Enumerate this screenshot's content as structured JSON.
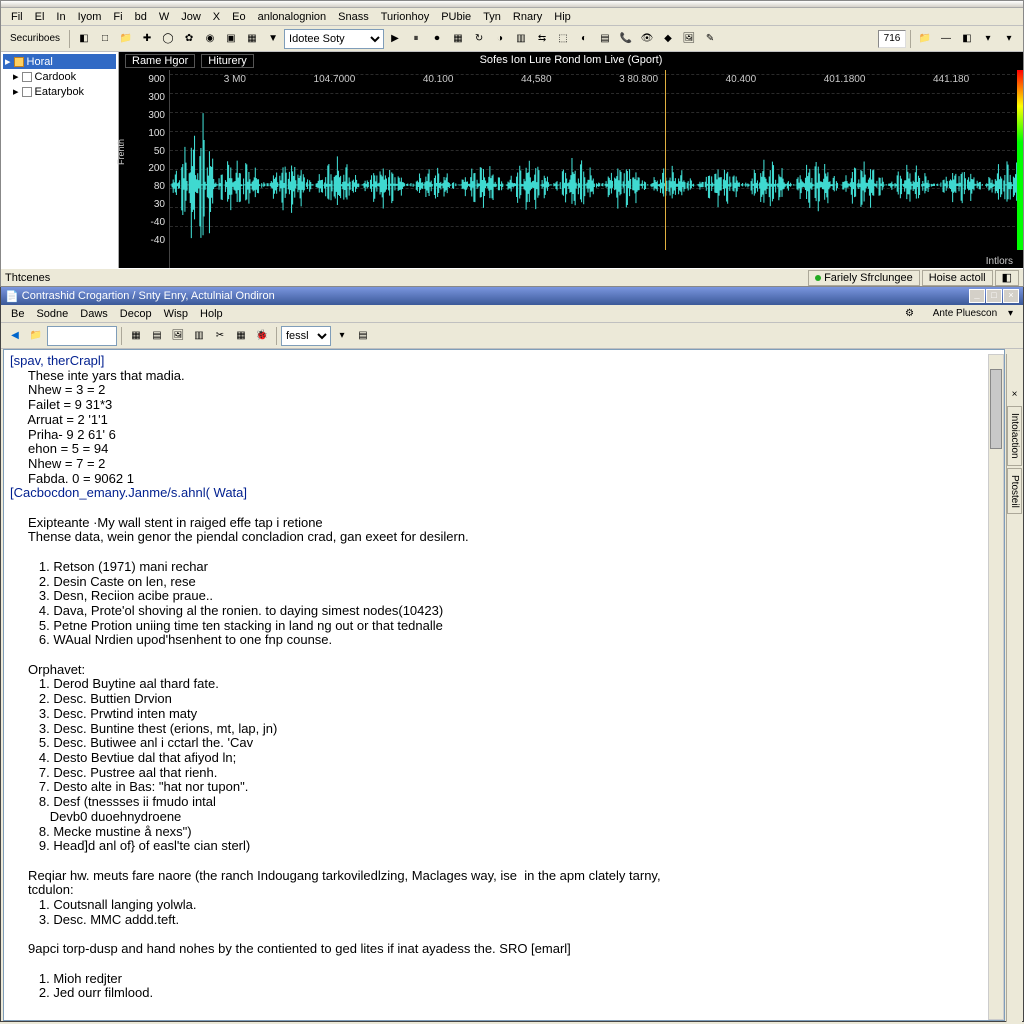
{
  "top_menu": [
    "Fil",
    "El",
    "In",
    "Iyom",
    "Fi",
    "bd",
    "W",
    "Jow",
    "X",
    "Eo",
    "anlonalognion",
    "Snass",
    "Turionhoy",
    "PUbie",
    "Tyn",
    "Rnary",
    "Hip"
  ],
  "top_toolbar": {
    "buttons": [
      "seq",
      "◧",
      "□",
      "📁",
      "✚",
      "◯",
      "✿",
      "◉",
      "▣",
      "▦",
      "▼",
      "sel",
      "▶",
      "⏸",
      "⏺",
      "▦",
      "↻",
      "◑",
      "▥",
      "⇆",
      "⬚",
      "◐",
      "▤",
      "📞",
      "👁",
      "◆",
      "🖼",
      "✎"
    ],
    "seq_label": "Securiboes",
    "select_value": "Idotee Soty",
    "num_display": "716",
    "right_icons": [
      "📁",
      "—",
      "◧",
      "▾",
      "▾"
    ]
  },
  "tree": {
    "root": "Horal",
    "items": [
      "Cardook",
      "Eatarybok"
    ]
  },
  "wave": {
    "tab_left": [
      "Rame Hgor",
      "Hiturery"
    ],
    "title": "Sofes Ion Lure Rond lom Live (Gport)",
    "ylabels": [
      "900",
      "300",
      "300",
      "100",
      "50",
      "200",
      "80",
      "30",
      "-40",
      "-40"
    ],
    "yaxis_label": "Frenth",
    "xlabels": [
      "3 M0",
      "104.7000",
      "40.100",
      "44,580",
      "3 80.800",
      "40.400",
      "401.1800",
      "441.180"
    ],
    "xunit": "Intlors"
  },
  "status": {
    "left": "Thtcenes",
    "r1": "Fariely Sfrclungee",
    "r2": "Hoise actoll"
  },
  "bot_title": "Contrashid Crogartion / Snty Enry, Actulnial Ondiron",
  "bot_menu": [
    "Be",
    "Sodne",
    "Daws",
    "Decop",
    "Wisp",
    "Holp"
  ],
  "bot_tool_right": "Ante Pluescon",
  "bot_toolbar": {
    "search": "",
    "combo": "fessl"
  },
  "right_tabs": [
    "Intoiaction",
    "Ptosteil"
  ],
  "editor_lines": [
    {
      "t": "[spav, therCrapl]",
      "c": "hdr"
    },
    {
      "t": "     These inte yars that madia.",
      "c": ""
    },
    {
      "t": "     Nhew = 3 = 2",
      "c": ""
    },
    {
      "t": "     Failet = 9 31*3",
      "c": ""
    },
    {
      "t": "     Arruat = 2 '1'1",
      "c": ""
    },
    {
      "t": "     Priha- 9 2 61' 6",
      "c": ""
    },
    {
      "t": "     ehon = 5 = 94",
      "c": ""
    },
    {
      "t": "     Nhew = 7 = 2",
      "c": ""
    },
    {
      "t": "     Fabda. 0 = 9062 1",
      "c": ""
    },
    {
      "t": "[Cacbocdon_emany.Janme/s.ahnl( Wata]",
      "c": "hdr"
    },
    {
      "t": "",
      "c": ""
    },
    {
      "t": "     Exipteante ·My wall stent in raiged effe tap i retione",
      "c": ""
    },
    {
      "t": "     Thense data, wein genor the piendal concladion crad, gan exeet for desilern.",
      "c": ""
    },
    {
      "t": "",
      "c": ""
    },
    {
      "t": "        1. Retson (1971) mani rechar",
      "c": ""
    },
    {
      "t": "        2. Desin Caste on len, rese",
      "c": ""
    },
    {
      "t": "        3. Desn, Reciion acibe praue..",
      "c": ""
    },
    {
      "t": "        4. Dava, Prote'ol shoving al the ronien. to daying simest nodes(10423)",
      "c": ""
    },
    {
      "t": "        5. Petne Protion uniing time ten stacking in land ng out or that tednalle",
      "c": ""
    },
    {
      "t": "        6. WAual Nrdien upod'hsenhent to one fnp counse.",
      "c": ""
    },
    {
      "t": "",
      "c": ""
    },
    {
      "t": "     Orphavet:",
      "c": ""
    },
    {
      "t": "        1. Derod Buytine aal thard fate.",
      "c": ""
    },
    {
      "t": "        2. Desc. Buttien Drvion",
      "c": ""
    },
    {
      "t": "        3. Desc. Prwtind inten maty",
      "c": ""
    },
    {
      "t": "        3. Desc. Buntine thest (erions, mt, lap, jn)",
      "c": ""
    },
    {
      "t": "        5. Desc. Butiwee anl i cctarl the. 'Cav",
      "c": ""
    },
    {
      "t": "        4. Desto Bevtiue dal that afiyod ln;",
      "c": ""
    },
    {
      "t": "        7. Desc. Pustree aal that rienh.",
      "c": ""
    },
    {
      "t": "        7. Desto alte in Bas: \"hat nor tupon\".",
      "c": ""
    },
    {
      "t": "        8. Desf (tnessses ii fmudo intal",
      "c": ""
    },
    {
      "t": "           Devb0 duoehnydroene",
      "c": ""
    },
    {
      "t": "        8. Mecke mustine å nexs\")",
      "c": ""
    },
    {
      "t": "        9. Head]d anl of} of easl'te cian sterl)",
      "c": ""
    },
    {
      "t": "",
      "c": ""
    },
    {
      "t": "     Reqiar hw. meuts fare naore (the ranch Indougang tarkoviledlzing, Maclages way, ise  in the apm clately tarny,",
      "c": ""
    },
    {
      "t": "     tcdulon:",
      "c": ""
    },
    {
      "t": "        1. Coutsnall langing yolwla.",
      "c": ""
    },
    {
      "t": "        3. Desc. MMC addd.teft.",
      "c": ""
    },
    {
      "t": "",
      "c": ""
    },
    {
      "t": "     9apci torp-dusp and hand nohes by the contiented to ged lites if inat ayadess the. SRO [emarl]",
      "c": ""
    },
    {
      "t": "",
      "c": ""
    },
    {
      "t": "        1. Mioh redjter",
      "c": ""
    },
    {
      "t": "        2. Jed ourr filmlood.",
      "c": ""
    }
  ]
}
